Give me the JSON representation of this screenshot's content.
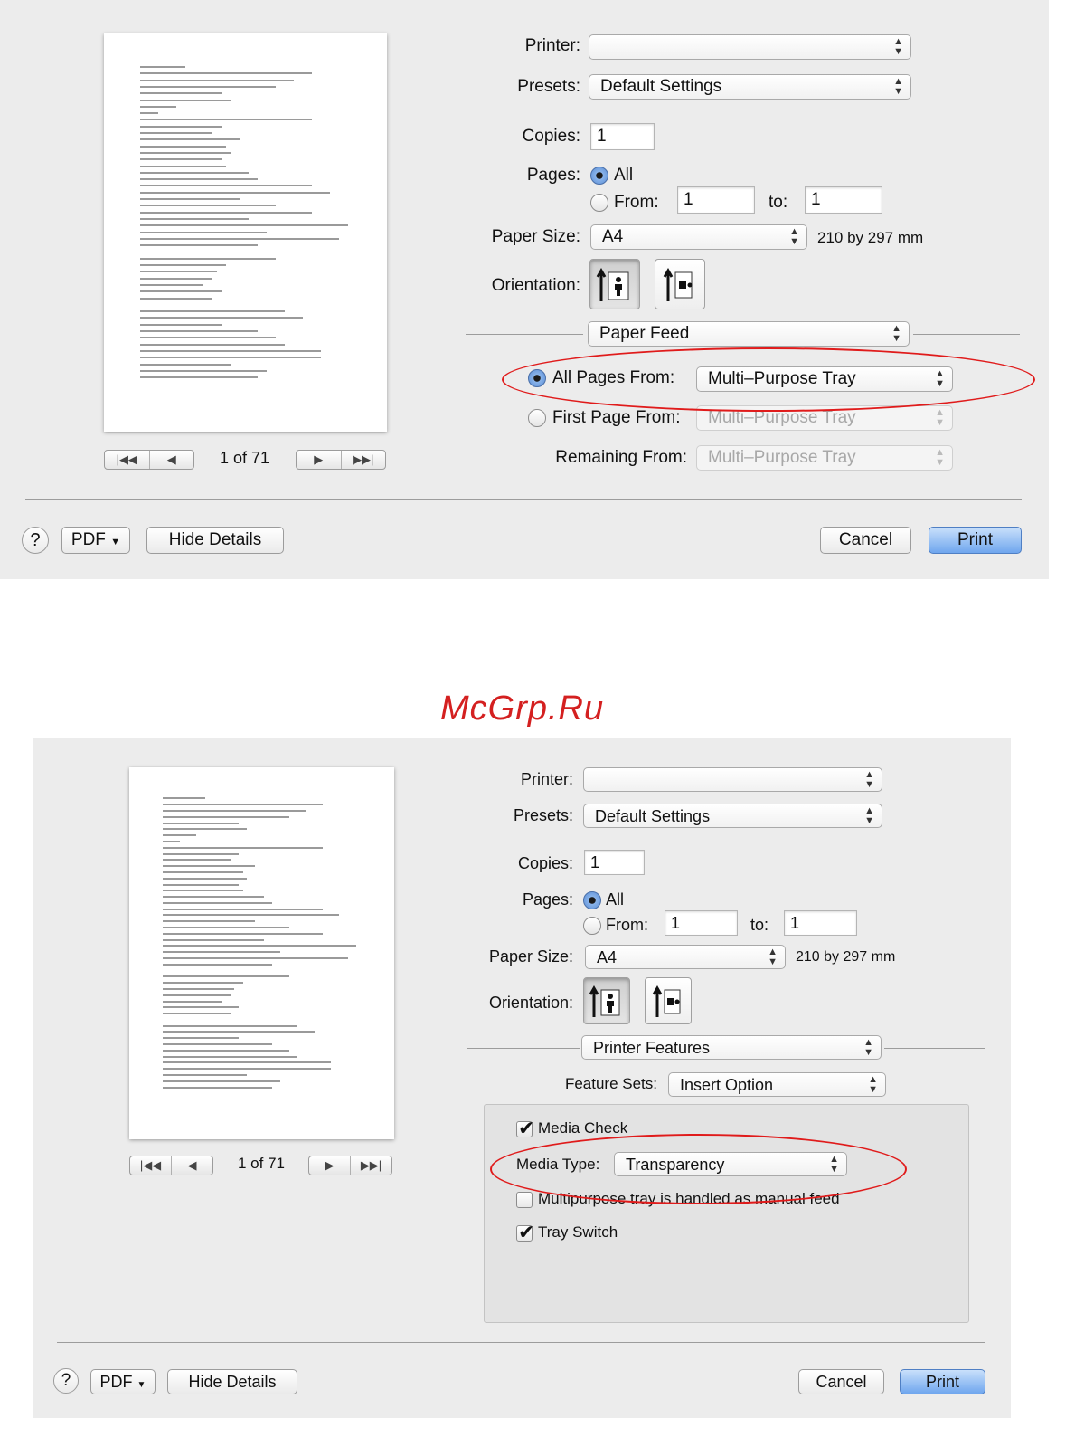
{
  "watermark": "McGrp.Ru",
  "dialog1": {
    "printer_label": "Printer:",
    "printer_value": "",
    "presets_label": "Presets:",
    "presets_value": "Default Settings",
    "copies_label": "Copies:",
    "copies_value": "1",
    "pages_label": "Pages:",
    "pages_all": "All",
    "pages_from": "From:",
    "from_value": "1",
    "to_label": "to:",
    "to_value": "1",
    "paper_size_label": "Paper Size:",
    "paper_size_value": "A4",
    "paper_size_dims": "210 by 297 mm",
    "orientation_label": "Orientation:",
    "section_value": "Paper Feed",
    "all_pages_from_label": "All Pages From:",
    "all_pages_from_value": "Multi–Purpose Tray",
    "first_page_from_label": "First Page From:",
    "first_page_from_value": "Multi–Purpose Tray",
    "remaining_from_label": "Remaining From:",
    "remaining_from_value": "Multi–Purpose Tray",
    "page_indicator": "1 of 71",
    "help": "?",
    "pdf": "PDF",
    "hide_details": "Hide Details",
    "cancel": "Cancel",
    "print": "Print"
  },
  "dialog2": {
    "printer_label": "Printer:",
    "printer_value": "",
    "presets_label": "Presets:",
    "presets_value": "Default Settings",
    "copies_label": "Copies:",
    "copies_value": "1",
    "pages_label": "Pages:",
    "pages_all": "All",
    "pages_from": "From:",
    "from_value": "1",
    "to_label": "to:",
    "to_value": "1",
    "paper_size_label": "Paper Size:",
    "paper_size_value": "A4",
    "paper_size_dims": "210 by 297 mm",
    "orientation_label": "Orientation:",
    "section_value": "Printer Features",
    "feature_sets_label": "Feature Sets:",
    "feature_sets_value": "Insert Option",
    "media_check": "Media Check",
    "media_type_label": "Media Type:",
    "media_type_value": "Transparency",
    "multipurpose_manual": "Multipurpose tray is handled as manual feed",
    "tray_switch": "Tray Switch",
    "page_indicator": "1 of 71",
    "help": "?",
    "pdf": "PDF",
    "hide_details": "Hide Details",
    "cancel": "Cancel",
    "print": "Print"
  },
  "icons": {
    "popup_arrows": "up-down-chevrons",
    "pdf_dropdown": "triangle-down",
    "pager_first": "skip-first",
    "pager_prev": "triangle-left",
    "pager_next": "triangle-right",
    "pager_last": "skip-last"
  },
  "colors": {
    "annotation": "#e01b1b",
    "primary_button": "#6fa6ee",
    "dialog_bg": "#ececec"
  }
}
